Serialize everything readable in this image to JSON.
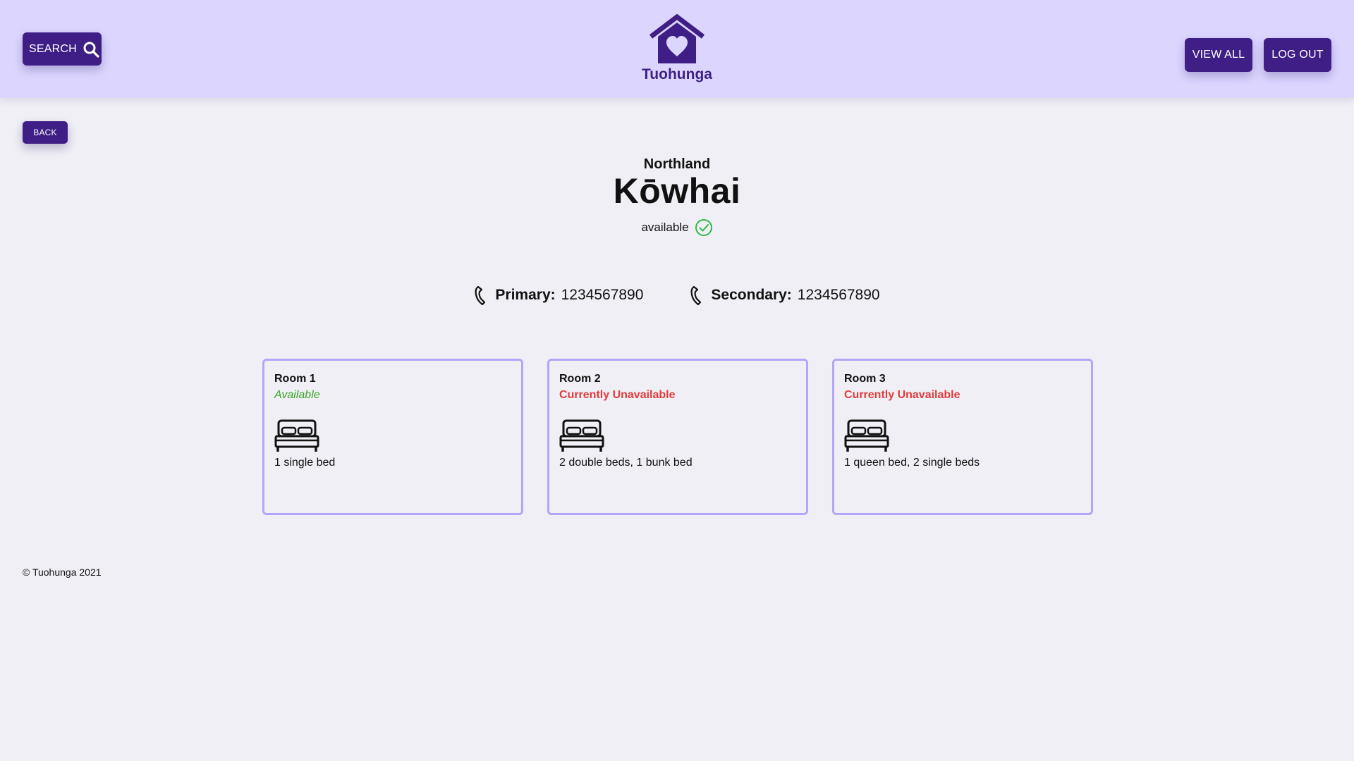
{
  "header": {
    "search_label": "SEARCH",
    "brand": "Tuohunga",
    "view_all_label": "VIEW ALL",
    "logout_label": "LOG OUT",
    "icons": {
      "search": "search-icon",
      "logo": "house-heart-logo"
    }
  },
  "back_label": "BACK",
  "place": {
    "region": "Northland",
    "name": "Kōwhai",
    "status": "available",
    "status_icon": "check-circle-icon"
  },
  "phones": {
    "primary_label": "Primary:",
    "primary_value": "1234567890",
    "secondary_label": "Secondary:",
    "secondary_value": "1234567890",
    "icon": "phone-icon"
  },
  "rooms": [
    {
      "name": "Room 1",
      "availability": "Available",
      "beds": "1 single bed"
    },
    {
      "name": "Room 2",
      "availability": "Currently Unavailable",
      "beds": "2 double beds, 1 bunk bed"
    },
    {
      "name": "Room 3",
      "availability": "Currently Unavailable",
      "beds": "1 queen bed, 2 single beds"
    }
  ],
  "footer": {
    "copyright": "© Tuohunga 2021"
  },
  "colors": {
    "header_bg": "#dcd6ff",
    "page_bg": "#f0eff5",
    "button": "#3f1f86",
    "card_border": "#b3a6f8",
    "available": "#3aa52a",
    "unavailable": "#e23b3b",
    "status_check": "#2fb84a"
  }
}
